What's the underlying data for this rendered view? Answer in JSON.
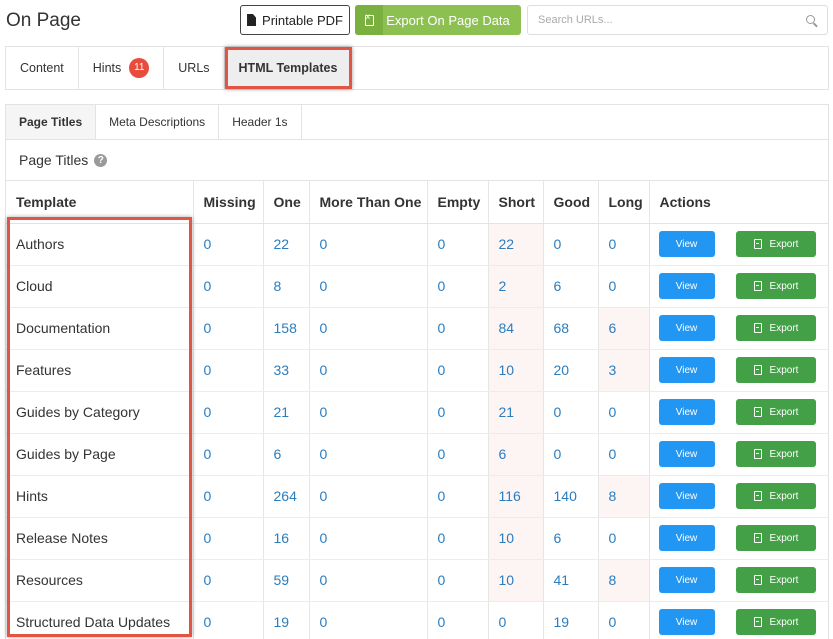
{
  "page": {
    "title": "On Page"
  },
  "toolbar": {
    "printable_pdf_label": "Printable PDF",
    "export_label": "Export On Page Data",
    "search_placeholder": "Search URLs..."
  },
  "main_tabs": [
    {
      "label": "Content"
    },
    {
      "label": "Hints",
      "badge": "11"
    },
    {
      "label": "URLs"
    },
    {
      "label": "HTML Templates",
      "active": true
    }
  ],
  "sub_tabs": [
    {
      "label": "Page Titles",
      "active": true
    },
    {
      "label": "Meta Descriptions"
    },
    {
      "label": "Header 1s"
    }
  ],
  "section": {
    "title": "Page Titles"
  },
  "table": {
    "headers": [
      "Template",
      "Missing",
      "One",
      "More Than One",
      "Empty",
      "Short",
      "Good",
      "Long",
      "Actions"
    ],
    "view_label": "View",
    "export_label": "Export",
    "rows": [
      {
        "template": "Authors",
        "missing": "0",
        "one": "22",
        "more_than_one": "0",
        "empty": "0",
        "short": "22",
        "good": "0",
        "long": "0"
      },
      {
        "template": "Cloud",
        "missing": "0",
        "one": "8",
        "more_than_one": "0",
        "empty": "0",
        "short": "2",
        "good": "6",
        "long": "0"
      },
      {
        "template": "Documentation",
        "missing": "0",
        "one": "158",
        "more_than_one": "0",
        "empty": "0",
        "short": "84",
        "good": "68",
        "long": "6"
      },
      {
        "template": "Features",
        "missing": "0",
        "one": "33",
        "more_than_one": "0",
        "empty": "0",
        "short": "10",
        "good": "20",
        "long": "3"
      },
      {
        "template": "Guides by Category",
        "missing": "0",
        "one": "21",
        "more_than_one": "0",
        "empty": "0",
        "short": "21",
        "good": "0",
        "long": "0"
      },
      {
        "template": "Guides by Page",
        "missing": "0",
        "one": "6",
        "more_than_one": "0",
        "empty": "0",
        "short": "6",
        "good": "0",
        "long": "0"
      },
      {
        "template": "Hints",
        "missing": "0",
        "one": "264",
        "more_than_one": "0",
        "empty": "0",
        "short": "116",
        "good": "140",
        "long": "8"
      },
      {
        "template": "Release Notes",
        "missing": "0",
        "one": "16",
        "more_than_one": "0",
        "empty": "0",
        "short": "10",
        "good": "6",
        "long": "0"
      },
      {
        "template": "Resources",
        "missing": "0",
        "one": "59",
        "more_than_one": "0",
        "empty": "0",
        "short": "10",
        "good": "41",
        "long": "8"
      },
      {
        "template": "Structured Data Updates",
        "missing": "0",
        "one": "19",
        "more_than_one": "0",
        "empty": "0",
        "short": "0",
        "good": "19",
        "long": "0"
      }
    ]
  },
  "colors": {
    "accent_blue": "#2196f3",
    "export_green": "#43a047",
    "highlight_red": "#e05545",
    "badge_red": "#e74c3c"
  }
}
